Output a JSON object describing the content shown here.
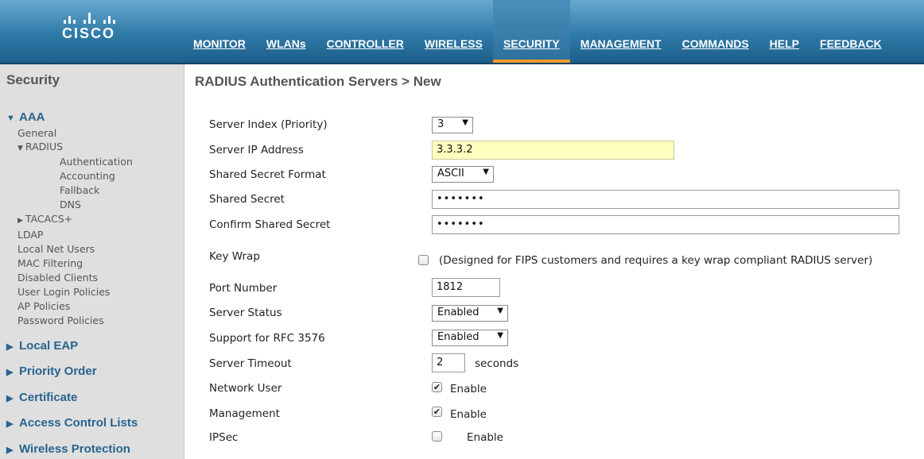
{
  "brand": {
    "logo_text": "CISCO"
  },
  "nav": [
    {
      "label": "MONITOR"
    },
    {
      "label": "WLANs"
    },
    {
      "label": "CONTROLLER"
    },
    {
      "label": "WIRELESS"
    },
    {
      "label": "SECURITY",
      "active": true
    },
    {
      "label": "MANAGEMENT"
    },
    {
      "label": "COMMANDS"
    },
    {
      "label": "HELP"
    },
    {
      "label": "FEEDBACK"
    }
  ],
  "sidebar": {
    "title": "Security",
    "aaa": {
      "label": "AAA",
      "general": "General",
      "radius": "RADIUS",
      "authentication": "Authentication",
      "accounting": "Accounting",
      "fallback": "Fallback",
      "dns": "DNS",
      "tacacs": "TACACS+",
      "ldap": "LDAP",
      "local_net_users": "Local Net Users",
      "mac_filtering": "MAC Filtering",
      "disabled_clients": "Disabled Clients",
      "user_login_policies": "User Login Policies",
      "ap_policies": "AP Policies",
      "password_policies": "Password Policies"
    },
    "sections": [
      {
        "label": "Local EAP"
      },
      {
        "label": "Priority Order"
      },
      {
        "label": "Certificate"
      },
      {
        "label": "Access Control Lists"
      },
      {
        "label": "Wireless Protection"
      }
    ]
  },
  "page": {
    "title": "RADIUS Authentication Servers > New"
  },
  "form": {
    "server_index": {
      "label": "Server Index (Priority)",
      "value": "3"
    },
    "server_ip": {
      "label": "Server IP Address",
      "value": "3.3.3.2"
    },
    "secret_format": {
      "label": "Shared Secret Format",
      "value": "ASCII"
    },
    "shared_secret": {
      "label": "Shared Secret",
      "value": "•••••••"
    },
    "confirm_secret": {
      "label": "Confirm Shared Secret",
      "value": "•••••••"
    },
    "key_wrap": {
      "label": "Key Wrap",
      "note": "(Designed for FIPS customers and requires a key wrap compliant RADIUS server)",
      "checked": false
    },
    "port_number": {
      "label": "Port Number",
      "value": "1812"
    },
    "server_status": {
      "label": "Server Status",
      "value": "Enabled"
    },
    "rfc3576": {
      "label": "Support for RFC 3576",
      "value": "Enabled"
    },
    "server_timeout": {
      "label": "Server Timeout",
      "value": "2",
      "unit": "seconds"
    },
    "network_user": {
      "label": "Network User",
      "option": "Enable",
      "checked": true
    },
    "management": {
      "label": "Management",
      "option": "Enable",
      "checked": true
    },
    "ipsec": {
      "label": "IPSec",
      "option": "Enable",
      "checked": false
    }
  },
  "colors": {
    "header_blue": "#2f7aa8",
    "active_underline": "#f19a2b",
    "sidebar_bg": "#dfdfdf",
    "sidebar_link": "#27648f",
    "ip_field_bg": "#ffffc0"
  },
  "icons": {
    "expanded": "triangle-down-icon",
    "collapsed": "triangle-right-icon",
    "dropdown": "caret-down-icon",
    "check": "checkmark-icon"
  }
}
